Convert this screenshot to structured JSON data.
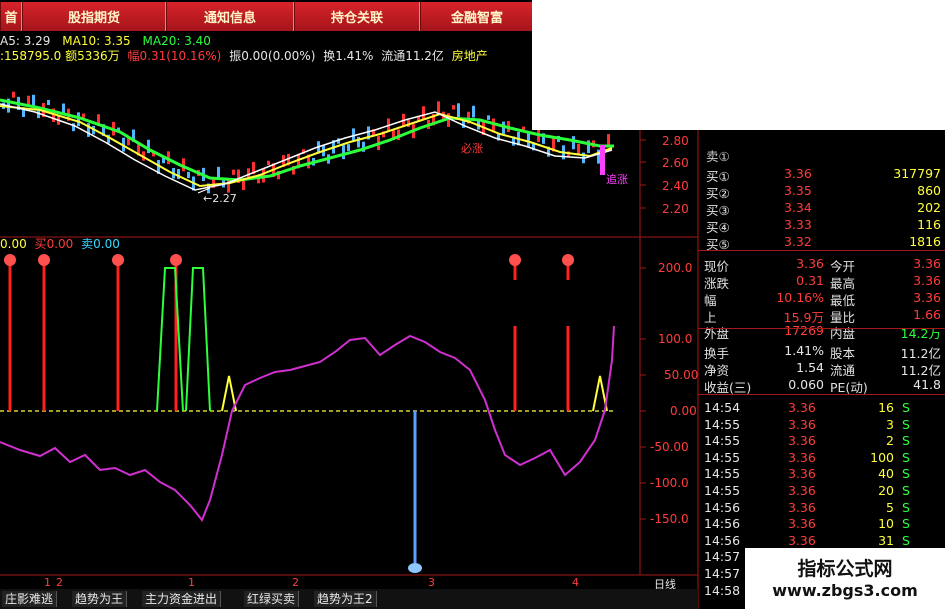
{
  "top_tabs": [
    "首",
    "股指期货",
    "通知信息",
    "持仓关联",
    "金融智富"
  ],
  "ma_line": {
    "ma5": "A5: 3.29",
    "ma10": "MA10: 3.35",
    "ma20": "MA20: 3.40"
  },
  "quote_line": {
    "volume": ":158795.0",
    "amount": "额5336万",
    "change": "幅0.31(10.16%)",
    "amplitude": "振0.00(0.00%)",
    "turnover": "换1.41%",
    "float": "流通11.2亿",
    "sector": "房地产"
  },
  "price_axis": [
    "2.80",
    "2.60",
    "2.40",
    "2.20"
  ],
  "chart_labels": {
    "low": "←2.27",
    "bisheng": "必涨",
    "zhuizhang": "追涨"
  },
  "indicator_header": {
    "v1": "0.00",
    "buy_label": "买",
    "buy": "0.00",
    "sell_label": "卖",
    "sell": "0.00"
  },
  "indicator_axis": [
    "200.0",
    "100.0",
    "50.00",
    "0.00",
    "-50.00",
    "-100.0",
    "-150.0"
  ],
  "x_axis": [
    "1",
    "2",
    "1",
    "2",
    "3",
    "4"
  ],
  "x_axis_right": "日线",
  "order_book": {
    "sell1_label": "卖①",
    "buys": [
      {
        "label": "买①",
        "price": "3.36",
        "vol": "317797"
      },
      {
        "label": "买②",
        "price": "3.35",
        "vol": "860"
      },
      {
        "label": "买③",
        "price": "3.34",
        "vol": "202"
      },
      {
        "label": "买④",
        "price": "3.33",
        "vol": "116"
      },
      {
        "label": "买⑤",
        "price": "3.32",
        "vol": "1816"
      }
    ]
  },
  "stats": [
    {
      "l1": "现价",
      "v1": "3.36",
      "l2": "今开",
      "v2": "3.36"
    },
    {
      "l1": "涨跌",
      "v1": "0.31",
      "l2": "最高",
      "v2": "3.36"
    },
    {
      "l1": "幅",
      "v1": "10.16%",
      "l2": "最低",
      "v2": "3.36"
    },
    {
      "l1": "上",
      "v1": "15.9万",
      "l2": "量比",
      "v2": "1.66"
    },
    {
      "l1": "外盘",
      "v1": "17269",
      "l2": "内盘",
      "v2": "14.2万"
    },
    {
      "l1": "换手",
      "v1": "1.41%",
      "l2": "股本",
      "v2": "11.2亿"
    },
    {
      "l1": "净资",
      "v1": "1.54",
      "l2": "流通",
      "v2": "11.2亿"
    },
    {
      "l1": "收益(三)",
      "v1": "0.060",
      "l2": "PE(动)",
      "v2": "41.8"
    }
  ],
  "ticks": [
    {
      "time": "14:54",
      "price": "3.36",
      "vol": "16",
      "side": "S"
    },
    {
      "time": "14:55",
      "price": "3.36",
      "vol": "3",
      "side": "S"
    },
    {
      "time": "14:55",
      "price": "3.36",
      "vol": "2",
      "side": "S"
    },
    {
      "time": "14:55",
      "price": "3.36",
      "vol": "100",
      "side": "S"
    },
    {
      "time": "14:55",
      "price": "3.36",
      "vol": "40",
      "side": "S"
    },
    {
      "time": "14:55",
      "price": "3.36",
      "vol": "20",
      "side": "S"
    },
    {
      "time": "14:56",
      "price": "3.36",
      "vol": "5",
      "side": "S"
    },
    {
      "time": "14:56",
      "price": "3.36",
      "vol": "10",
      "side": "S"
    },
    {
      "time": "14:56",
      "price": "3.36",
      "vol": "31",
      "side": "S"
    },
    {
      "time": "14:57",
      "price": "",
      "vol": "",
      "side": ""
    },
    {
      "time": "14:57",
      "price": "",
      "vol": "",
      "side": ""
    },
    {
      "time": "14:58",
      "price": "",
      "vol": "",
      "side": ""
    }
  ],
  "bottom_tabs": [
    "庄影难逃",
    "趋势为王",
    "主力资金进出",
    "红绿买卖",
    "趋势为王2"
  ],
  "watermark": {
    "title": "指标公式网",
    "url": "www.zbgs3.com"
  },
  "colors": {
    "up": "#ff3c3c",
    "down": "#2cff3c",
    "ma5": "#ffffff",
    "ma10": "#ffff3c",
    "ma20": "#2cff3c",
    "indicator": "#d030d0"
  }
}
